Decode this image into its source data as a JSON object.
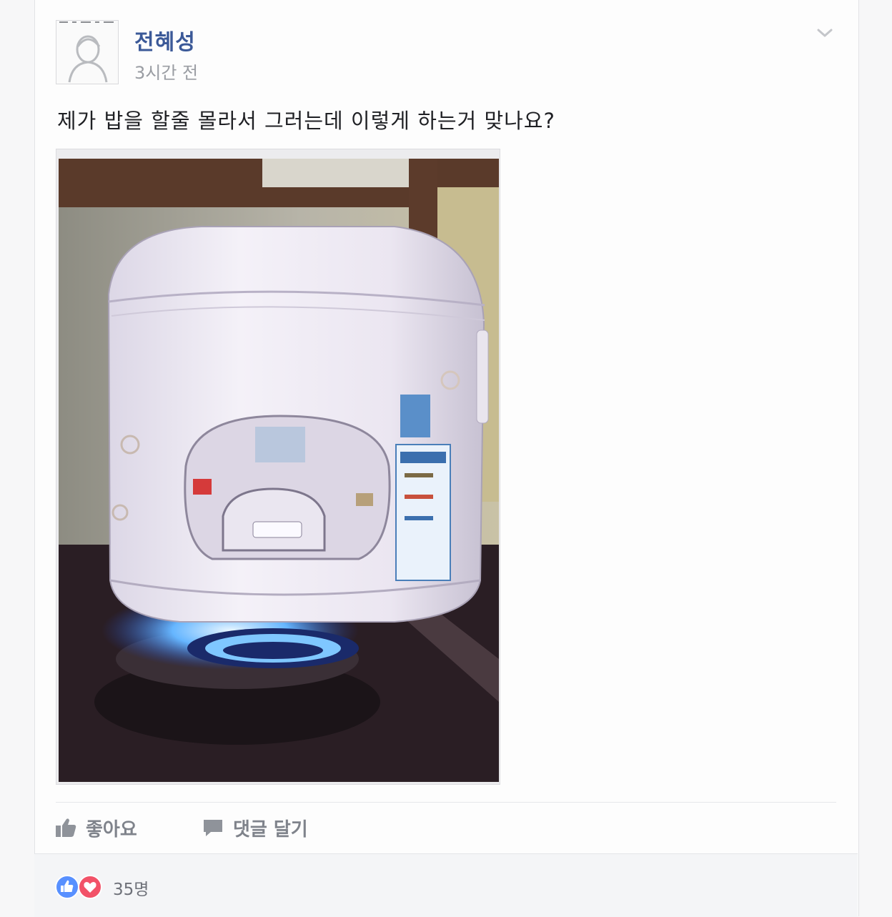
{
  "post": {
    "author": "전혜성",
    "timestamp": "3시간 전",
    "text": "제가 밥을 할줄 몰라서 그러는데 이렇게 하는거 맞나요?"
  },
  "actions": {
    "like_label": "좋아요",
    "comment_label": "댓글 달기"
  },
  "reactions": {
    "count": "35명",
    "types": [
      "like",
      "love"
    ],
    "colors": {
      "like": "#5890ff",
      "love": "#f25268"
    }
  },
  "icons": {
    "menu": "chevron-down-icon",
    "like": "thumbs-up-icon",
    "comment": "speech-bubble-icon",
    "avatar": "default-avatar-silhouette"
  },
  "colors": {
    "author": "#3b5998",
    "muted": "#9a9da3",
    "action": "#7f838b"
  }
}
